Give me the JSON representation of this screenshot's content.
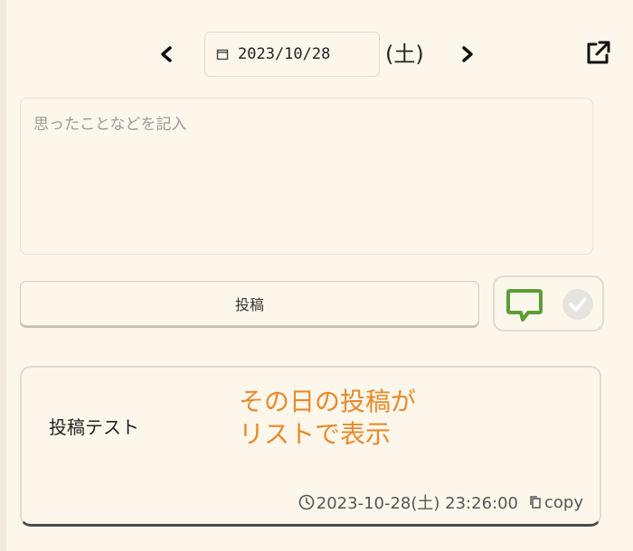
{
  "header": {
    "date": "2023/10/28",
    "weekday": "(土)"
  },
  "memo": {
    "placeholder": "思ったことなどを記入"
  },
  "actions": {
    "post_label": "投稿"
  },
  "post": {
    "text": "投稿テスト",
    "annotation": "その日の投稿が\nリストで表示",
    "timestamp": "2023-10-28(土) 23:26:00",
    "copy_label": "copy"
  },
  "colors": {
    "background": "#fdf7eb",
    "accent_green": "#5a9e34",
    "annotation_orange": "#e8892b"
  },
  "icons": [
    "chevron-left-icon",
    "calendar-icon",
    "chevron-right-icon",
    "external-link-icon",
    "speech-bubble-icon",
    "check-circle-icon",
    "clock-icon",
    "copy-icon"
  ]
}
